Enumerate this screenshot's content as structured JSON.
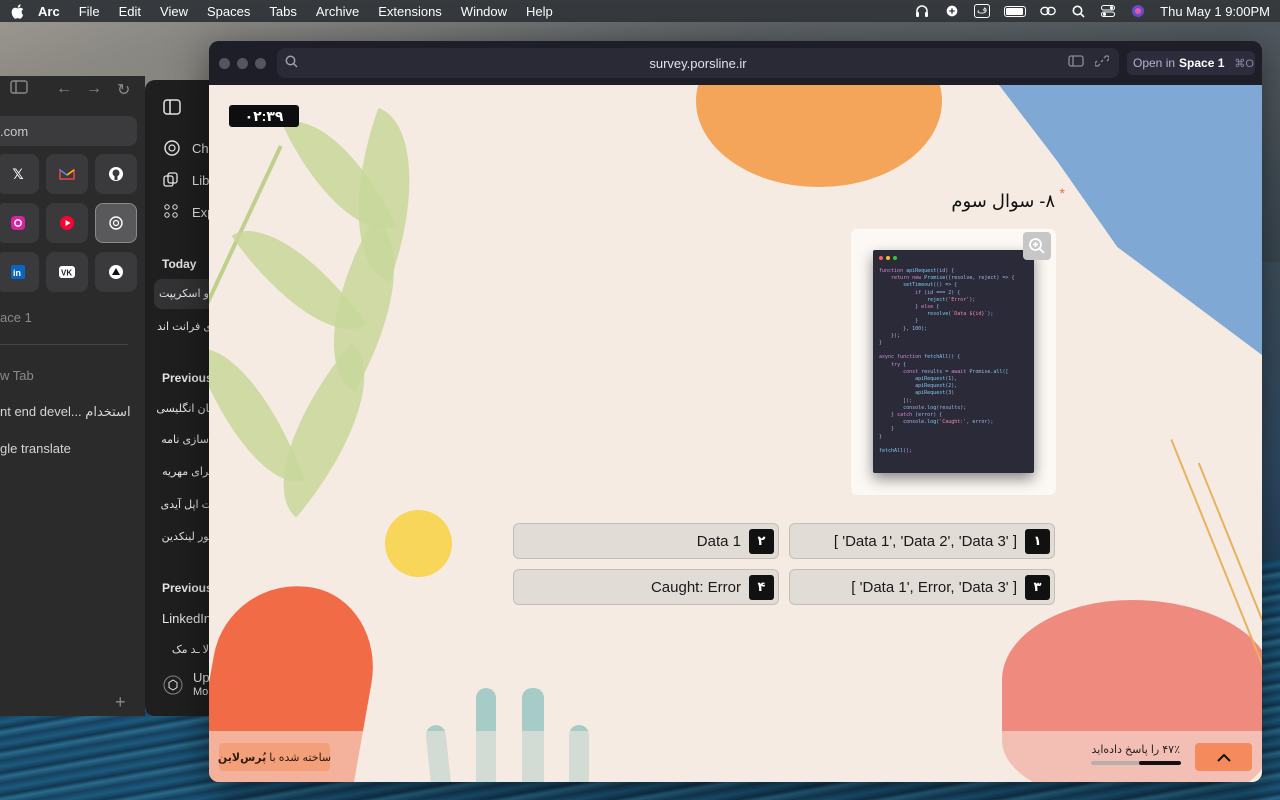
{
  "menubar": {
    "apple_icon": "apple-icon",
    "app_name": "Arc",
    "items": [
      "File",
      "Edit",
      "View",
      "Spaces",
      "Tabs",
      "Archive",
      "Extensions",
      "Window",
      "Help"
    ],
    "input_lang": "ف",
    "datetime": "Thu May 1  9:00PM"
  },
  "back_window": {
    "url_fragment": ".com",
    "tiles_row1": [
      "𝕏",
      "M",
      "⌥"
    ],
    "space_label": "ace 1",
    "new_tab": "w Tab",
    "tab1": "nt end devel... استخدام",
    "tab2": "gle translate"
  },
  "chat_sidebar": {
    "item1": "Ch",
    "item2": "Lib",
    "item3": "Exp",
    "today_heading": "Today",
    "today_items": [
      "او اسکریپت",
      "ی فرانت اند"
    ],
    "previous_heading": "Previous",
    "previous_items": [
      "تان انگلیسی",
      "اسازی نامه",
      "برای مهریه",
      "ت اپل آیدی",
      "بور لینکدین"
    ],
    "previous_heading_2": "Previous",
    "previous_items_2": [
      "LinkedIn",
      "ٔالا ـد مک"
    ],
    "upgrade": "Up",
    "upgrade_sub": "Mo"
  },
  "browser": {
    "url": "survey.porsline.ir",
    "open_in": "Open in",
    "space_name": "Space 1",
    "shortcut": "⌘O"
  },
  "survey": {
    "timer": "۰۲:۳۹",
    "question_title": "۸- سوال سوم",
    "required_mark": "*",
    "options": [
      {
        "num": "۱",
        "text": "[ 'Data 1', 'Data 2', 'Data 3' ]"
      },
      {
        "num": "۲",
        "text": "Data 1"
      },
      {
        "num": "۳",
        "text": "[ 'Data 1', Error, 'Data 3' ]"
      },
      {
        "num": "۴",
        "text": "Caught: Error"
      }
    ],
    "brand_prefix": "ساخته شده با",
    "brand_name": "پُرس‌لاین",
    "progress_label": "۴۷٪ را پاسخ داده‌اید",
    "progress_value": 0.47
  },
  "colors": {
    "accent_orange": "#f58a5c",
    "page_bg": "#f5ebe2"
  }
}
